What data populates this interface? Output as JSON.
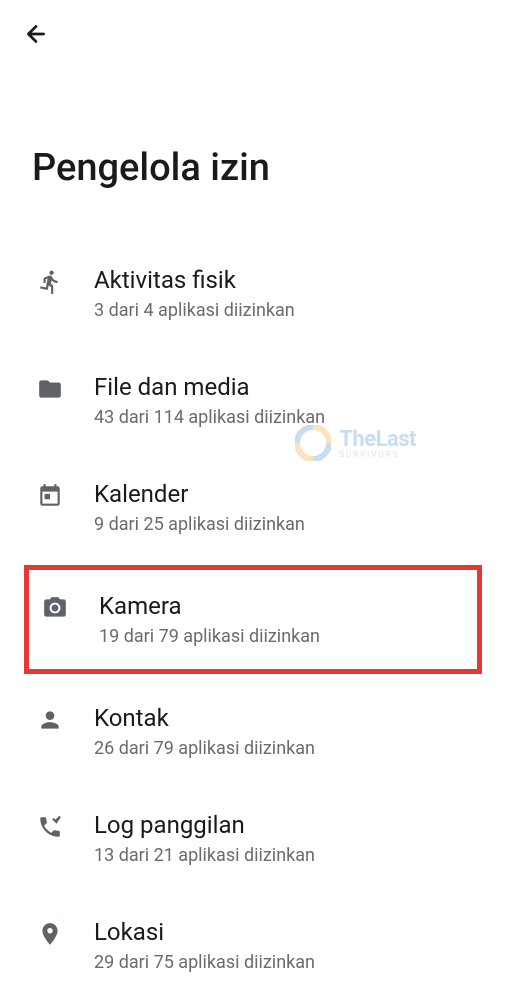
{
  "header": {
    "title": "Pengelola izin"
  },
  "permissions": [
    {
      "icon": "running",
      "title": "Aktivitas fisik",
      "subtitle": "3 dari 4 aplikasi diizinkan",
      "highlighted": false
    },
    {
      "icon": "folder",
      "title": "File dan media",
      "subtitle": "43 dari 114 aplikasi diizinkan",
      "highlighted": false
    },
    {
      "icon": "calendar",
      "title": "Kalender",
      "subtitle": "9 dari 25 aplikasi diizinkan",
      "highlighted": false
    },
    {
      "icon": "camera",
      "title": "Kamera",
      "subtitle": "19 dari 79 aplikasi diizinkan",
      "highlighted": true
    },
    {
      "icon": "contact",
      "title": "Kontak",
      "subtitle": "26 dari 79 aplikasi diizinkan",
      "highlighted": false
    },
    {
      "icon": "phone-log",
      "title": "Log panggilan",
      "subtitle": "13 dari 21 aplikasi diizinkan",
      "highlighted": false
    },
    {
      "icon": "location",
      "title": "Lokasi",
      "subtitle": "29 dari 75 aplikasi diizinkan",
      "highlighted": false
    }
  ],
  "watermark": {
    "text": "TheLast",
    "sub": "SURVIVORS"
  }
}
